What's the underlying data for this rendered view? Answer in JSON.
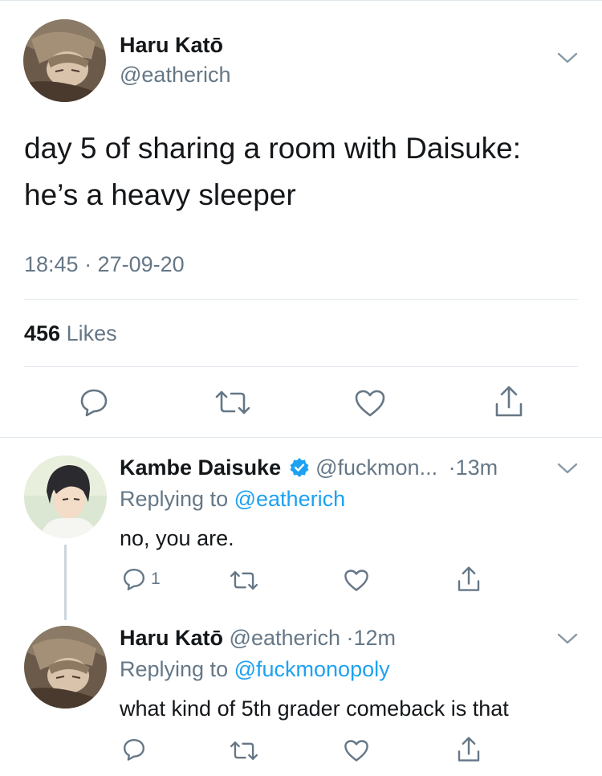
{
  "main_tweet": {
    "name": "Haru Katō",
    "handle": "@eatherich",
    "text_line1": "day 5 of sharing a room with Daisuke:",
    "text_line2": "he’s a heavy sleeper",
    "timestamp": "18:45 · 27-09-20",
    "likes_count": "456",
    "likes_label": "Likes"
  },
  "reply1": {
    "name": "Kambe Daisuke",
    "handle": "@fuckmon...",
    "time": "·13m",
    "replying_prefix": "Replying to",
    "replying_to": "@eatherich",
    "text": "no, you are.",
    "reply_count": "1"
  },
  "reply2": {
    "name": "Haru Katō",
    "handle": "@eatherich",
    "time": "·12m",
    "replying_prefix": "Replying to",
    "replying_to": "@fuckmonopoly",
    "text": "what kind of 5th grader comeback is that"
  },
  "colors": {
    "text": "#14171a",
    "secondary": "#657786",
    "accent": "#1da1f2",
    "divider": "#e1e8ed"
  }
}
